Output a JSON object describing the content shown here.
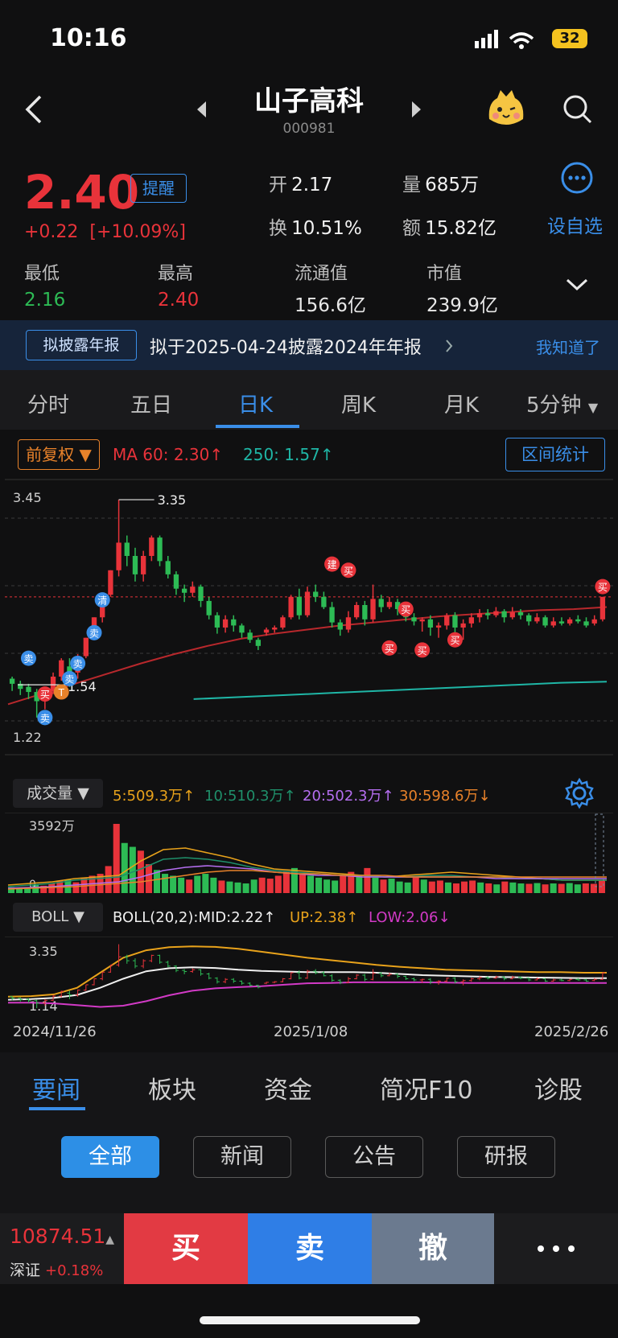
{
  "status": {
    "time": "10:16",
    "battery": "32"
  },
  "header": {
    "title": "山子高科",
    "code": "000981"
  },
  "quote": {
    "price": "2.40",
    "remind_label": "提醒",
    "change": "+0.22",
    "change_pct": "[+10.09%]",
    "open_label": "开",
    "open": "2.17",
    "volume_label": "量",
    "volume": "685万",
    "turnover_label": "换",
    "turnover": "10.51%",
    "amount_label": "额",
    "amount": "15.82亿",
    "add_watch": "设自选",
    "low_label": "最低",
    "low": "2.16",
    "high_label": "最高",
    "high": "2.40",
    "float_cap_label": "流通值",
    "float_cap": "156.6亿",
    "market_cap_label": "市值",
    "market_cap": "239.9亿"
  },
  "banner": {
    "tag": "拟披露年报",
    "text": "拟于2025-04-24披露2024年年报",
    "dismiss": "我知道了"
  },
  "period_tabs": [
    "分时",
    "五日",
    "日K",
    "周K",
    "月K",
    "5分钟"
  ],
  "chart_toolbar": {
    "adjust": "前复权",
    "ma60": "MA 60: 2.30",
    "ma250": "250: 1.57",
    "range_stats": "区间统计"
  },
  "volume_toolbar": {
    "label": "成交量",
    "v5": "5:509.3万",
    "v10": "10:510.3万",
    "v20": "20:502.3万",
    "v30": "30:598.6万",
    "max": "3592万",
    "zero": "0"
  },
  "boll_toolbar": {
    "label": "BOLL",
    "params": "BOLL(20,2):",
    "mid": "MID:2.22",
    "up": "UP:2.38",
    "low": "LOW:2.06"
  },
  "dates": [
    "2024/11/26",
    "2025/1/08",
    "2025/2/26"
  ],
  "markers": {
    "buy": "买",
    "sell": "卖",
    "build": "建",
    "clear": "清",
    "t": "T"
  },
  "colors": {
    "up": "#e8333a",
    "down": "#2dbb55",
    "accent": "#3a8ee8",
    "ma60": "#b8282c",
    "ma250": "#1fb6a6",
    "boll_up": "#e8a21b",
    "boll_mid": "#f0f0f0",
    "boll_low": "#d23ac6"
  },
  "chart_data": [
    {
      "type": "candlestick",
      "y_labels": [
        "3.45",
        "1.22"
      ],
      "annotations": [
        "3.35",
        "1.54"
      ],
      "ylim": [
        1.14,
        3.5
      ],
      "candles": [
        {
          "o": 1.6,
          "c": 1.55,
          "h": 1.62,
          "l": 1.48
        },
        {
          "o": 1.55,
          "c": 1.5,
          "h": 1.58,
          "l": 1.44
        },
        {
          "o": 1.52,
          "c": 1.47,
          "h": 1.55,
          "l": 1.4
        },
        {
          "o": 1.47,
          "c": 1.38,
          "h": 1.5,
          "l": 1.22
        },
        {
          "o": 1.4,
          "c": 1.48,
          "h": 1.52,
          "l": 1.3
        },
        {
          "o": 1.48,
          "c": 1.62,
          "h": 1.66,
          "l": 1.45
        },
        {
          "o": 1.62,
          "c": 1.78,
          "h": 1.8,
          "l": 1.58
        },
        {
          "o": 1.72,
          "c": 1.66,
          "h": 1.8,
          "l": 1.52
        },
        {
          "o": 1.66,
          "c": 1.82,
          "h": 1.84,
          "l": 1.6
        },
        {
          "o": 1.82,
          "c": 2.0,
          "h": 2.0,
          "l": 1.8
        },
        {
          "o": 2.0,
          "c": 2.2,
          "h": 2.2,
          "l": 1.98
        },
        {
          "o": 2.2,
          "c": 2.42,
          "h": 2.42,
          "l": 2.15
        },
        {
          "o": 2.42,
          "c": 2.66,
          "h": 2.66,
          "l": 2.4
        },
        {
          "o": 2.66,
          "c": 2.93,
          "h": 3.35,
          "l": 2.6
        },
        {
          "o": 2.93,
          "c": 2.8,
          "h": 3.0,
          "l": 2.7
        },
        {
          "o": 2.8,
          "c": 2.62,
          "h": 2.88,
          "l": 2.55
        },
        {
          "o": 2.62,
          "c": 2.8,
          "h": 2.85,
          "l": 2.55
        },
        {
          "o": 2.8,
          "c": 2.98,
          "h": 3.0,
          "l": 2.75
        },
        {
          "o": 2.98,
          "c": 2.75,
          "h": 3.0,
          "l": 2.7
        },
        {
          "o": 2.75,
          "c": 2.62,
          "h": 2.8,
          "l": 2.58
        },
        {
          "o": 2.62,
          "c": 2.48,
          "h": 2.65,
          "l": 2.42
        },
        {
          "o": 2.48,
          "c": 2.44,
          "h": 2.52,
          "l": 2.35
        },
        {
          "o": 2.44,
          "c": 2.5,
          "h": 2.55,
          "l": 2.4
        },
        {
          "o": 2.5,
          "c": 2.36,
          "h": 2.52,
          "l": 2.3
        },
        {
          "o": 2.36,
          "c": 2.22,
          "h": 2.4,
          "l": 2.18
        },
        {
          "o": 2.22,
          "c": 2.1,
          "h": 2.25,
          "l": 2.04
        },
        {
          "o": 2.1,
          "c": 2.18,
          "h": 2.22,
          "l": 2.05
        },
        {
          "o": 2.18,
          "c": 2.12,
          "h": 2.22,
          "l": 2.06
        },
        {
          "o": 2.12,
          "c": 2.05,
          "h": 2.14,
          "l": 2.0
        },
        {
          "o": 2.05,
          "c": 1.98,
          "h": 2.08,
          "l": 1.95
        },
        {
          "o": 1.98,
          "c": 1.92,
          "h": 2.0,
          "l": 1.88
        },
        {
          "o": 2.05,
          "c": 2.08,
          "h": 2.1,
          "l": 2.02
        },
        {
          "o": 2.08,
          "c": 2.1,
          "h": 2.12,
          "l": 2.05
        },
        {
          "o": 2.1,
          "c": 2.2,
          "h": 2.22,
          "l": 2.08
        },
        {
          "o": 2.2,
          "c": 2.4,
          "h": 2.42,
          "l": 2.18
        },
        {
          "o": 2.4,
          "c": 2.22,
          "h": 2.48,
          "l": 2.18
        },
        {
          "o": 2.22,
          "c": 2.45,
          "h": 2.5,
          "l": 2.2
        },
        {
          "o": 2.45,
          "c": 2.4,
          "h": 2.52,
          "l": 2.35
        },
        {
          "o": 2.4,
          "c": 2.3,
          "h": 2.45,
          "l": 2.28
        },
        {
          "o": 2.3,
          "c": 2.15,
          "h": 2.35,
          "l": 2.1
        },
        {
          "o": 2.15,
          "c": 2.08,
          "h": 2.18,
          "l": 2.02
        },
        {
          "o": 2.08,
          "c": 2.2,
          "h": 2.26,
          "l": 2.05
        },
        {
          "o": 2.2,
          "c": 2.32,
          "h": 2.35,
          "l": 2.18
        },
        {
          "o": 2.32,
          "c": 2.18,
          "h": 2.36,
          "l": 2.12
        },
        {
          "o": 2.18,
          "c": 2.38,
          "h": 2.52,
          "l": 2.15
        },
        {
          "o": 2.38,
          "c": 2.3,
          "h": 2.42,
          "l": 2.25
        },
        {
          "o": 2.3,
          "c": 2.35,
          "h": 2.4,
          "l": 2.28
        },
        {
          "o": 2.35,
          "c": 2.28,
          "h": 2.38,
          "l": 2.22
        },
        {
          "o": 2.28,
          "c": 2.2,
          "h": 2.3,
          "l": 2.16
        },
        {
          "o": 2.2,
          "c": 2.16,
          "h": 2.24,
          "l": 2.12
        },
        {
          "o": 2.16,
          "c": 2.18,
          "h": 2.2,
          "l": 2.06
        },
        {
          "o": 2.18,
          "c": 2.1,
          "h": 2.22,
          "l": 2.02
        },
        {
          "o": 2.1,
          "c": 2.12,
          "h": 2.15,
          "l": 2.0
        },
        {
          "o": 2.12,
          "c": 2.22,
          "h": 2.24,
          "l": 2.08
        },
        {
          "o": 2.22,
          "c": 2.1,
          "h": 2.25,
          "l": 2.05
        },
        {
          "o": 2.1,
          "c": 2.14,
          "h": 2.18,
          "l": 1.98
        },
        {
          "o": 2.14,
          "c": 2.2,
          "h": 2.24,
          "l": 2.1
        },
        {
          "o": 2.2,
          "c": 2.24,
          "h": 2.28,
          "l": 2.15
        },
        {
          "o": 2.24,
          "c": 2.22,
          "h": 2.28,
          "l": 2.18
        },
        {
          "o": 2.22,
          "c": 2.26,
          "h": 2.3,
          "l": 2.2
        },
        {
          "o": 2.26,
          "c": 2.2,
          "h": 2.28,
          "l": 2.15
        },
        {
          "o": 2.2,
          "c": 2.25,
          "h": 2.3,
          "l": 2.18
        },
        {
          "o": 2.25,
          "c": 2.22,
          "h": 2.28,
          "l": 2.18
        },
        {
          "o": 2.22,
          "c": 2.16,
          "h": 2.24,
          "l": 2.12
        },
        {
          "o": 2.16,
          "c": 2.2,
          "h": 2.24,
          "l": 2.14
        },
        {
          "o": 2.2,
          "c": 2.12,
          "h": 2.22,
          "l": 2.1
        },
        {
          "o": 2.12,
          "c": 2.16,
          "h": 2.2,
          "l": 2.1
        },
        {
          "o": 2.16,
          "c": 2.14,
          "h": 2.2,
          "l": 2.12
        },
        {
          "o": 2.14,
          "c": 2.18,
          "h": 2.2,
          "l": 2.12
        },
        {
          "o": 2.18,
          "c": 2.16,
          "h": 2.22,
          "l": 2.14
        },
        {
          "o": 2.16,
          "c": 2.12,
          "h": 2.2,
          "l": 2.1
        },
        {
          "o": 2.14,
          "c": 2.18,
          "h": 2.22,
          "l": 2.12
        },
        {
          "o": 2.18,
          "c": 2.4,
          "h": 2.4,
          "l": 2.16
        }
      ],
      "ma60": [
        1.35,
        1.45,
        1.55,
        1.65,
        1.75,
        1.84,
        1.92,
        1.99,
        2.04,
        2.08,
        2.12,
        2.15,
        2.18,
        2.21,
        2.23,
        2.25,
        2.27,
        2.28,
        2.3
      ],
      "ma250": [
        1.4,
        1.42,
        1.44,
        1.46,
        1.48,
        1.5,
        1.52,
        1.54,
        1.56,
        1.57
      ]
    },
    {
      "type": "bar",
      "ylim": [
        0,
        3592
      ],
      "values": [
        300,
        250,
        280,
        420,
        380,
        520,
        650,
        700,
        560,
        800,
        900,
        1000,
        1400,
        3592,
        2600,
        2400,
        2200,
        1500,
        1200,
        1000,
        900,
        800,
        700,
        900,
        1000,
        800,
        650,
        600,
        550,
        500,
        700,
        800,
        750,
        900,
        1100,
        1300,
        1000,
        900,
        800,
        700,
        650,
        900,
        1100,
        900,
        1300,
        800,
        700,
        750,
        600,
        550,
        800,
        700,
        600,
        650,
        550,
        500,
        600,
        650,
        550,
        500,
        450,
        600,
        550,
        500,
        480,
        520,
        450,
        500,
        480,
        520,
        450,
        500,
        480,
        685
      ]
    }
  ]
}
